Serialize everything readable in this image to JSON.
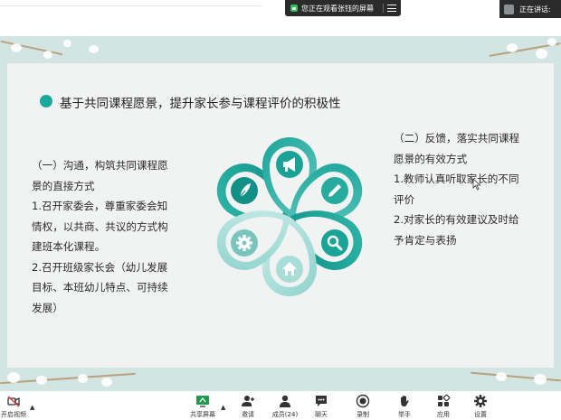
{
  "share_banner": {
    "text": "您正在观看张钰的屏幕"
  },
  "speaker": {
    "label": "正在讲话:"
  },
  "slide": {
    "title": "基于共同课程愿景，提升家长参与课程评价的积极性",
    "left_lines": [
      "（一）沟通，构筑共同课程愿",
      "景的直接方式",
      "1.召开家委会，尊重家委会知",
      "情权，以共商、共议的方式构",
      "建班本化课程。",
      "2.召开班级家长会（幼儿发展",
      "目标、本班幼儿特点、可持续",
      "发展）"
    ],
    "right_lines": [
      "（二）反馈，落实共同课程",
      "愿景的有效方式",
      "1.教师认真听取家长的不同",
      "评价",
      "2.对家长的有效建议及时给",
      "予肯定与表扬"
    ],
    "flower_icons": [
      "feather-icon",
      "megaphone-icon",
      "pen-icon",
      "search-icon",
      "home-icon",
      "gear-icon"
    ],
    "accent_color": "#1aa99a"
  },
  "toolbar": {
    "video_label": "开启视频",
    "share_label": "共享屏幕",
    "invite_label": "邀请",
    "members_label": "成员(24)",
    "chat_label": "聊天",
    "record_label": "录制",
    "raise_hand_label": "举手",
    "apps_label": "应用",
    "settings_label": "设置"
  }
}
